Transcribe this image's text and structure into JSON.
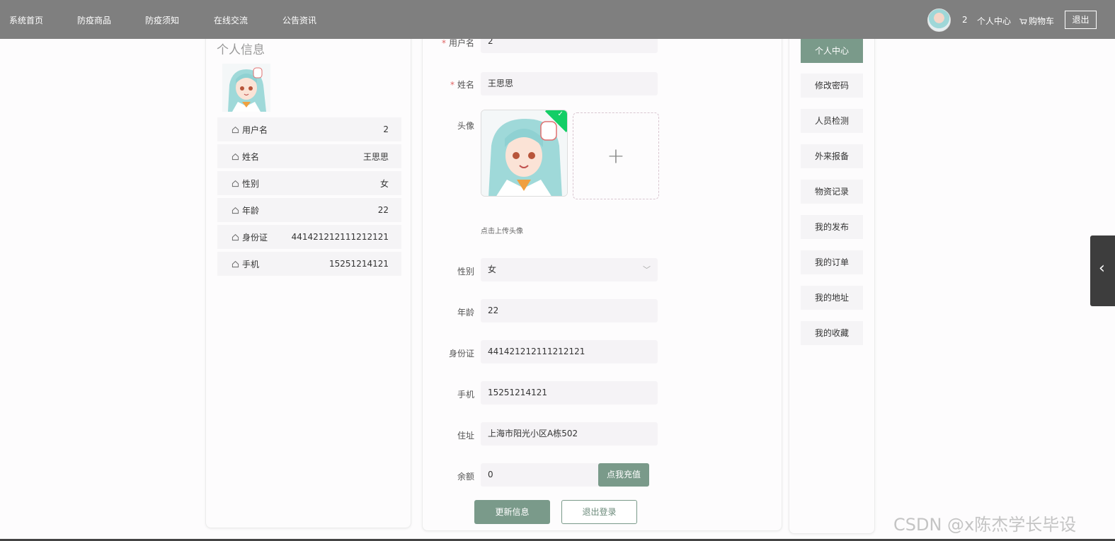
{
  "nav": {
    "items": [
      "系统首页",
      "防疫商品",
      "防疫须知",
      "在线交流",
      "公告资讯"
    ],
    "user": "2",
    "center": "个人中心",
    "cart": "购物车",
    "logout": "退出"
  },
  "profile": {
    "title": "个人信息",
    "rows": [
      {
        "label": "用户名",
        "value": "2"
      },
      {
        "label": "姓名",
        "value": "王思思"
      },
      {
        "label": "性别",
        "value": "女"
      },
      {
        "label": "年龄",
        "value": "22"
      },
      {
        "label": "身份证",
        "value": "441421212111212121"
      },
      {
        "label": "手机",
        "value": "15251214121"
      }
    ]
  },
  "form": {
    "username_label": "用户名",
    "username": "2",
    "name_label": "姓名",
    "name": "王思思",
    "avatar_label": "头像",
    "avatar_hint": "点击上传头像",
    "gender_label": "性别",
    "gender": "女",
    "age_label": "年龄",
    "age": "22",
    "id_label": "身份证",
    "id": "441421212111212121",
    "phone_label": "手机",
    "phone": "15251214121",
    "address_label": "住址",
    "address": "上海市阳光小区A栋502",
    "balance_label": "余额",
    "balance": "0",
    "recharge": "点我充值",
    "update": "更新信息",
    "logout": "退出登录"
  },
  "menu": [
    "个人中心",
    "修改密码",
    "人员检测",
    "外来报备",
    "物资记录",
    "我的发布",
    "我的订单",
    "我的地址",
    "我的收藏"
  ],
  "watermark": "CSDN @x陈杰学长毕设"
}
